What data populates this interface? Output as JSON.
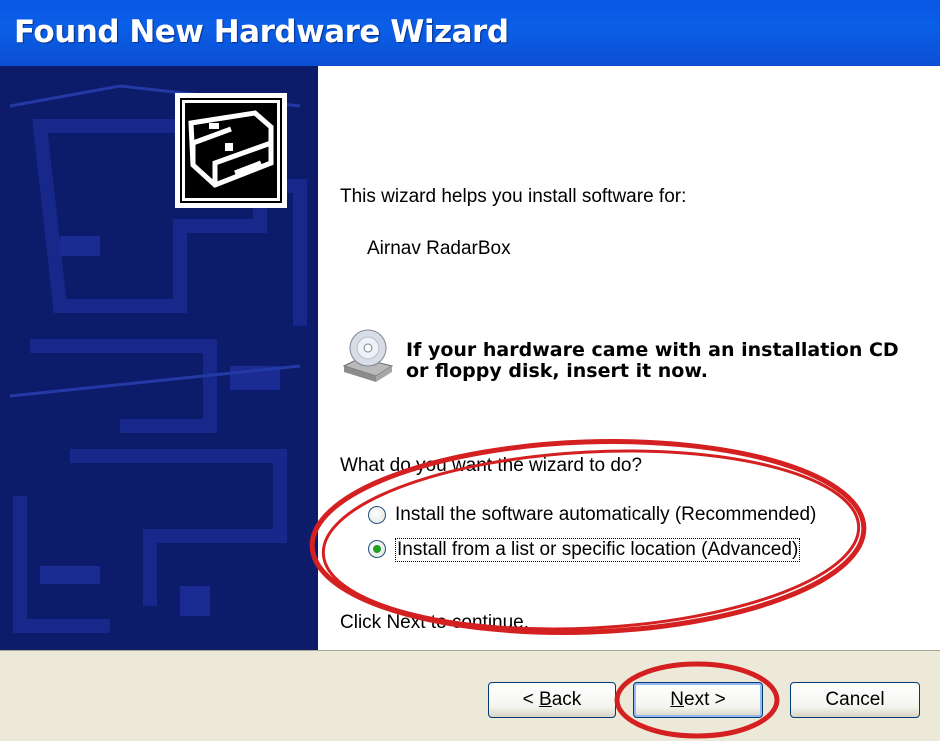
{
  "window": {
    "title": "Found New Hardware Wizard"
  },
  "intro": {
    "helps_text": "This wizard helps you install software for:",
    "device_name": "Airnav RadarBox"
  },
  "cd_notice": {
    "line1": "If your hardware came with an installation CD",
    "line2": "or floppy disk, insert it now."
  },
  "question": "What do you want the wizard to do?",
  "options": [
    {
      "label": "Install the software automatically (Recommended)",
      "selected": false
    },
    {
      "label": "Install from a list or specific location (Advanced)",
      "selected": true
    }
  ],
  "continue_text": "Click Next to continue.",
  "buttons": {
    "back_prefix": "< ",
    "back_accel": "B",
    "back_rest": "ack",
    "next_accel": "N",
    "next_rest": "ext >",
    "cancel": "Cancel"
  },
  "annotation_color": "#d42020"
}
